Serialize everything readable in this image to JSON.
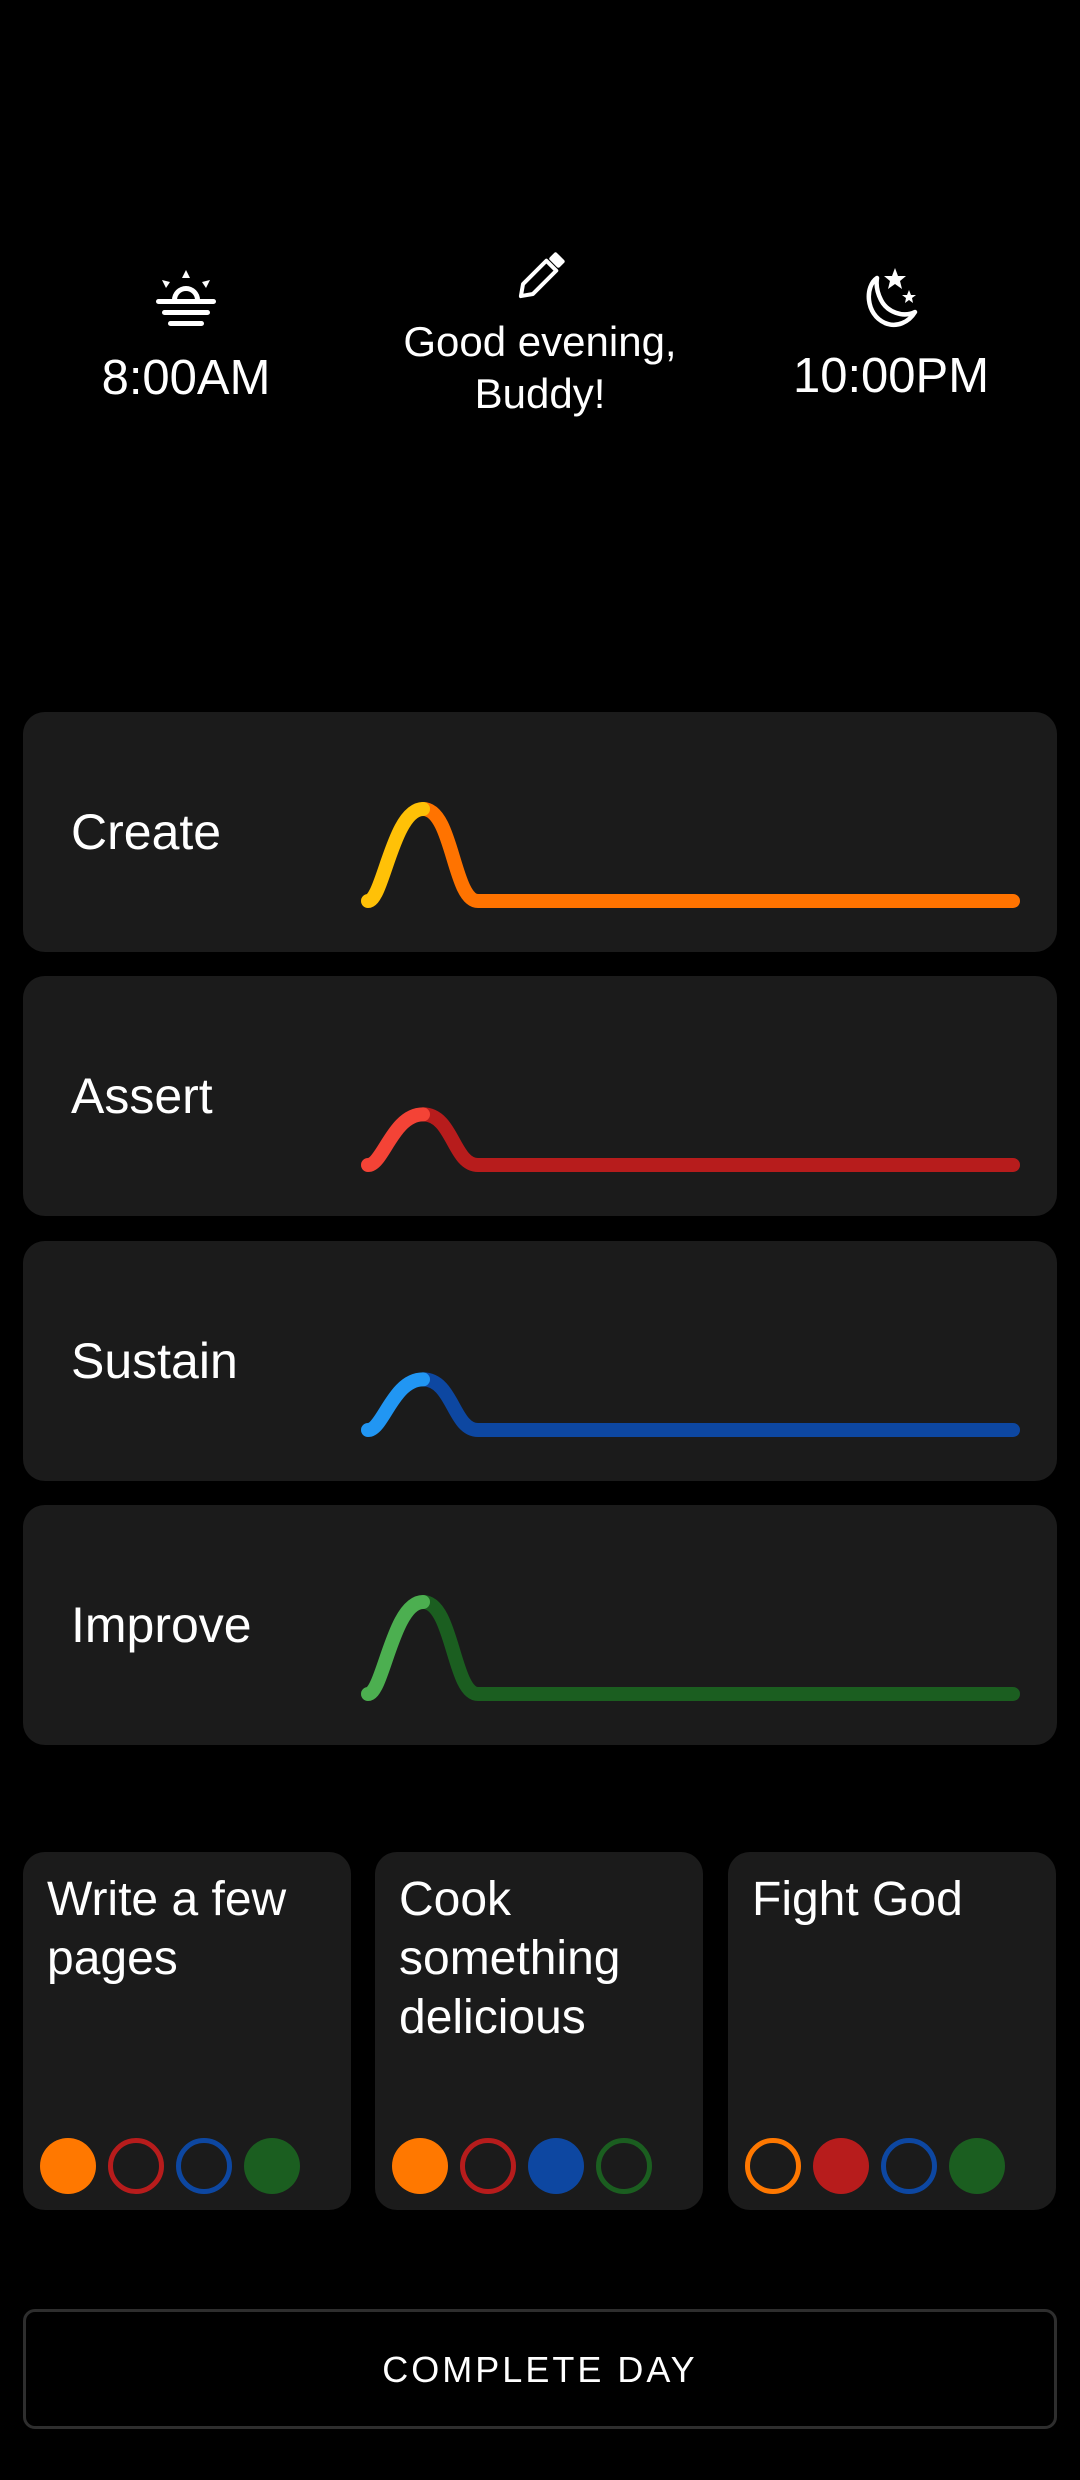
{
  "header": {
    "wake": {
      "icon": "sunrise-icon",
      "time": "8:00AM"
    },
    "greeting": {
      "icon": "pencil-icon",
      "line1": "Good evening,",
      "line2": "Buddy!"
    },
    "sleep": {
      "icon": "moon-stars-icon",
      "time": "10:00PM"
    }
  },
  "categories": [
    {
      "label": "Create",
      "peak": 1.0,
      "color_light": "#FFC107",
      "color_dark": "#FF7300"
    },
    {
      "label": "Assert",
      "peak": 0.55,
      "color_light": "#F44336",
      "color_dark": "#B71C1C"
    },
    {
      "label": "Sustain",
      "peak": 0.55,
      "color_light": "#2196F3",
      "color_dark": "#0D47A1"
    },
    {
      "label": "Improve",
      "peak": 1.0,
      "color_light": "#4CAF50",
      "color_dark": "#1B5E20"
    }
  ],
  "tasks": [
    {
      "title": "Write a few pages",
      "flags": [
        true,
        false,
        false,
        true
      ]
    },
    {
      "title": "Cook something delicious",
      "flags": [
        true,
        false,
        true,
        false
      ]
    },
    {
      "title": "Fight God",
      "flags": [
        false,
        true,
        false,
        true
      ]
    }
  ],
  "flag_colors": [
    "#FF7800",
    "#B71C1C",
    "#0D47A1",
    "#1B5E20"
  ],
  "complete_button": {
    "label": "COMPLETE DAY"
  }
}
